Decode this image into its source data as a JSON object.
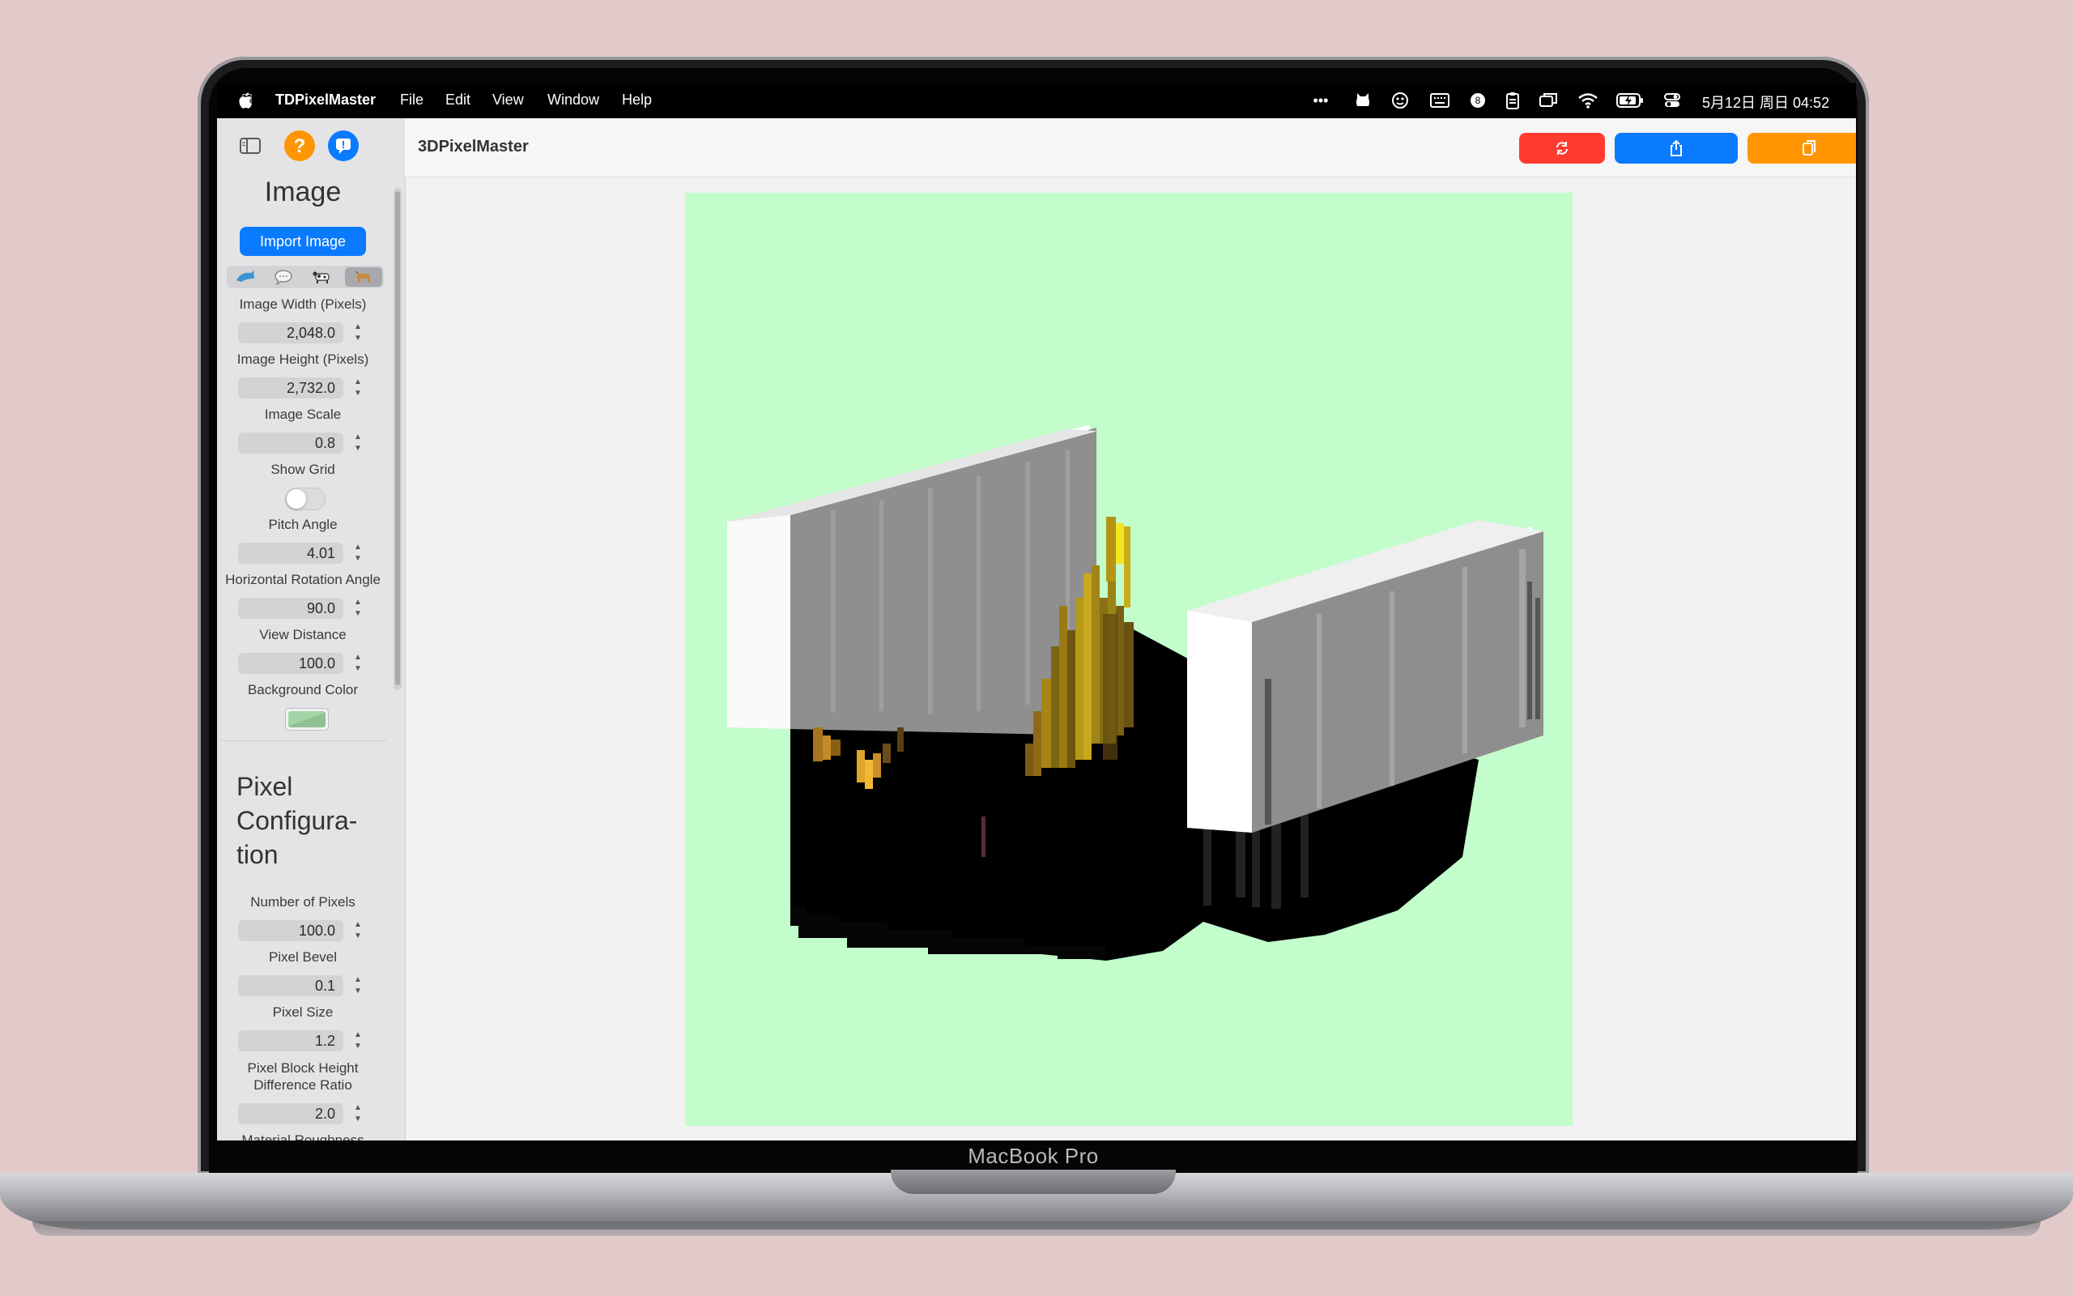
{
  "menubar": {
    "app_name": "TDPixelMaster",
    "menus": [
      "File",
      "Edit",
      "View",
      "Window",
      "Help"
    ],
    "clock": "5月12日 周日 04:52"
  },
  "device_label": "MacBook Pro",
  "toolbar": {
    "title": "3DPixelMaster",
    "buttons": [
      {
        "name": "refresh-button",
        "icon": "refresh-icon",
        "color": "#ff3b30"
      },
      {
        "name": "share-button",
        "icon": "share-icon",
        "color": "#0a7aff"
      },
      {
        "name": "copy-button",
        "icon": "copy-icon",
        "color": "#ff9500"
      }
    ]
  },
  "sidebar": {
    "image_section": {
      "title": "Image",
      "import_button": "Import Image",
      "presets": [
        "dolphin",
        "speech-bubble",
        "cow",
        "dog"
      ],
      "fields": [
        {
          "label": "Image Width (Pixels)",
          "value": "2,048.0"
        },
        {
          "label": "Image Height (Pixels)",
          "value": "2,732.0"
        },
        {
          "label": "Image Scale",
          "value": "0.8"
        },
        {
          "label": "Show Grid",
          "toggle": false
        },
        {
          "label": "Pitch Angle",
          "value": "4.01"
        },
        {
          "label": "Horizontal Rotation Angle",
          "value": "90.0"
        },
        {
          "label": "View Distance",
          "value": "100.0"
        },
        {
          "label": "Background Color",
          "color": "#a3d6a7"
        }
      ]
    },
    "pixel_section": {
      "title_lines": [
        "Pixel",
        "Configura-",
        "tion"
      ],
      "fields": [
        {
          "label": "Number of Pixels",
          "value": "100.0"
        },
        {
          "label": "Pixel Bevel",
          "value": "0.1"
        },
        {
          "label": "Pixel Size",
          "value": "1.2"
        },
        {
          "label_lines": [
            "Pixel Block Height",
            "Difference Ratio"
          ],
          "value": "2.0"
        },
        {
          "label": "Material Roughness"
        }
      ]
    }
  },
  "canvas": {
    "background": "#c2fdcb"
  }
}
